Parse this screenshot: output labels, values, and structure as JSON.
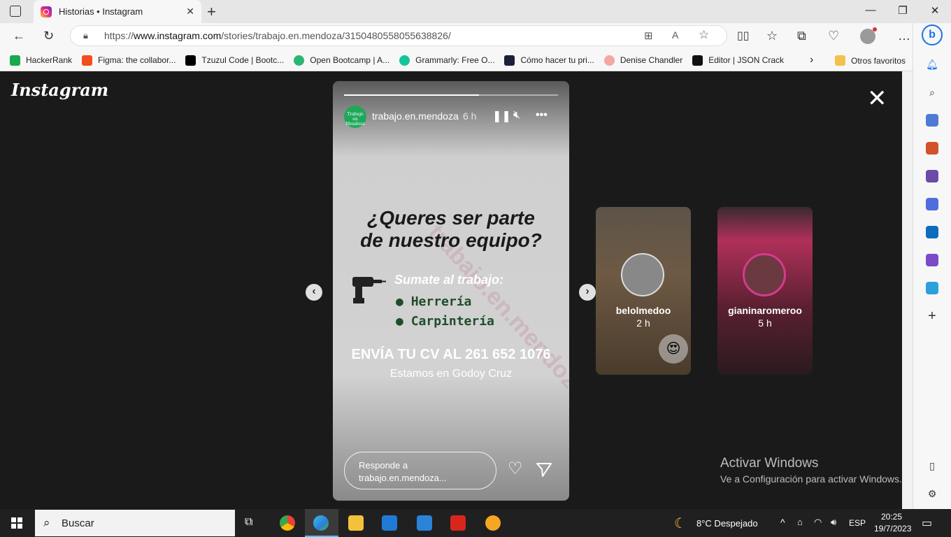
{
  "browser": {
    "tab_title": "Historias • Instagram",
    "url_prefix": "https://",
    "url_host": "www.instagram.com",
    "url_path": "/stories/trabajo.en.mendoza/3150480558055638826/"
  },
  "bookmarks": [
    {
      "label": "HackerRank",
      "color": "#1ba94c"
    },
    {
      "label": "Figma: the collabor...",
      "color": "#f24e1e"
    },
    {
      "label": "Tzuzul Code | Bootc...",
      "color": "#000000"
    },
    {
      "label": "Open Bootcamp | A...",
      "color": "#2bb673"
    },
    {
      "label": "Grammarly: Free O...",
      "color": "#15c39a"
    },
    {
      "label": "Cómo hacer tu pri...",
      "color": "#1d1f3a"
    },
    {
      "label": "Denise Chandler",
      "color": "#f4a6a0"
    },
    {
      "label": "Editor | JSON Crack",
      "color": "#111111"
    }
  ],
  "bookmarks_other": "Otros favoritos",
  "page": {
    "logo": "Instagram",
    "close_symbol": "✕"
  },
  "story": {
    "username": "trabajo.en.mendoza",
    "time": "6 h",
    "avatar_text": "Trabajo en Mendoza",
    "progress_percent": 63,
    "headline_line1": "¿Queres ser parte",
    "headline_line2": "de nuestro equipo?",
    "sumate": "Sumate al trabajo:",
    "jobs": [
      "Herrería",
      "Carpintería"
    ],
    "cv_text": "ENVÍA TU CV AL 261 652 1076",
    "location_text": "Estamos en Godoy Cruz",
    "watermark": "trabajo.en.mendoza",
    "reply_placeholder": "Responde a trabajo.en.mendoza..."
  },
  "thumbnails": [
    {
      "username": "belolmedoo",
      "time": "2 h"
    },
    {
      "username": "gianinaromeroo",
      "time": "5 h"
    }
  ],
  "watermark_windows": {
    "title": "Activar Windows",
    "subtitle": "Ve a Configuración para activar Windows."
  },
  "taskbar": {
    "search_placeholder": "Buscar",
    "weather": "8°C  Despejado",
    "language": "ESP",
    "time": "20:25",
    "date": "19/7/2023"
  }
}
